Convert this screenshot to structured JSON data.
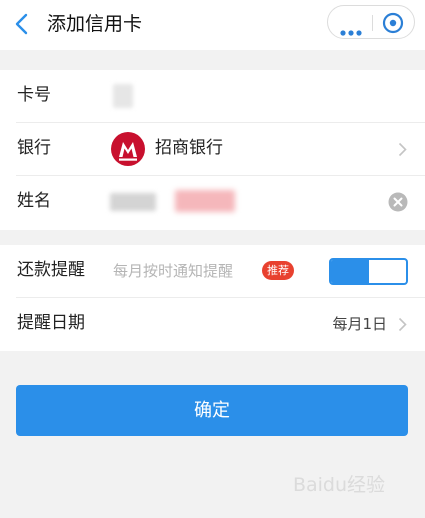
{
  "header": {
    "title": "添加信用卡",
    "icons": {
      "back": "back-arrow-icon",
      "more": "more-dots-icon",
      "close": "close-target-icon"
    }
  },
  "form": {
    "card_number": {
      "label": "卡号"
    },
    "bank": {
      "label": "银行",
      "value": "招商银行",
      "logo_color": "#c8102e"
    },
    "name": {
      "label": "姓名"
    },
    "reminder": {
      "label": "还款提醒",
      "placeholder": "每月按时通知提醒",
      "badge": "推荐",
      "toggle_on": true
    },
    "reminder_date": {
      "label": "提醒日期",
      "value": "每月1日"
    }
  },
  "confirm_button": {
    "label": "确定"
  },
  "colors": {
    "accent": "#2b8fe9",
    "badge": "#e8412f",
    "background": "#f2f2f2"
  },
  "watermark": "Baidu经验"
}
